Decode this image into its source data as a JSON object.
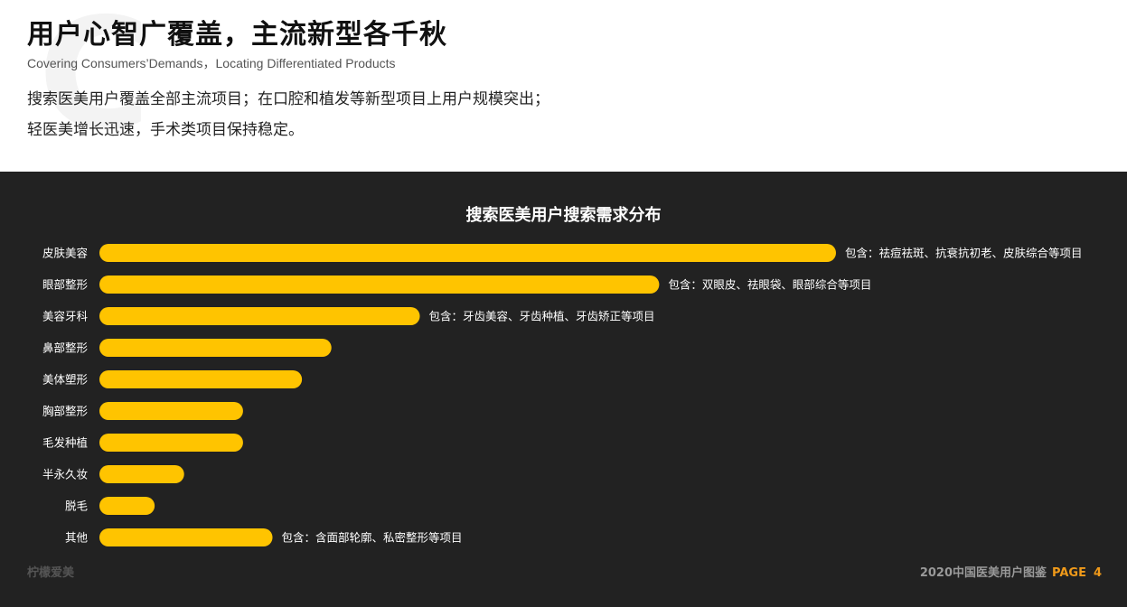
{
  "header": {
    "title": "用户心智广覆盖，主流新型各千秋",
    "subtitle": "Covering Consumers’Demands，Locating Differentiated Products",
    "desc_line1": "搜索医美用户覆盖全部主流项目；在口腔和植发等新型项目上用户规模突出；",
    "desc_line2": "轻医美增长迅速，手术类项目保持稳定。"
  },
  "colors": {
    "panel_bg": "#222222",
    "bar": "#ffc400",
    "accent": "#f09a1a"
  },
  "chart_data": {
    "type": "bar",
    "orientation": "horizontal",
    "title": "搜索医美用户搜索需求分布",
    "categories": [
      "皮肤美容",
      "眼部整形",
      "美容牙科",
      "鼻部整形",
      "美体塑形",
      "胸部整形",
      "毛发种植",
      "半永久妆",
      "脱毛",
      "其他"
    ],
    "values": [
      100,
      76,
      43.5,
      31.5,
      27.5,
      19.5,
      19.5,
      11.5,
      7.5,
      23.5
    ],
    "annotations": [
      "包含：祛痘祛斑、抗衰抗初老、皮肤综合等项目",
      "包含：双眼皮、祛眼袋、眼部综合等项目",
      "包含：牙齿美容、牙齿种植、牙齿矫正等项目",
      "",
      "",
      "",
      "",
      "",
      "",
      "包含：含面部轮廓、私密整形等项目"
    ],
    "xlim": [
      0,
      100
    ],
    "grid": false,
    "legend": "none"
  },
  "footer": {
    "brand": "柠檬爱美",
    "report": "2020中国医美用户图鉴",
    "page_word": "PAGE",
    "page_num": "4"
  }
}
